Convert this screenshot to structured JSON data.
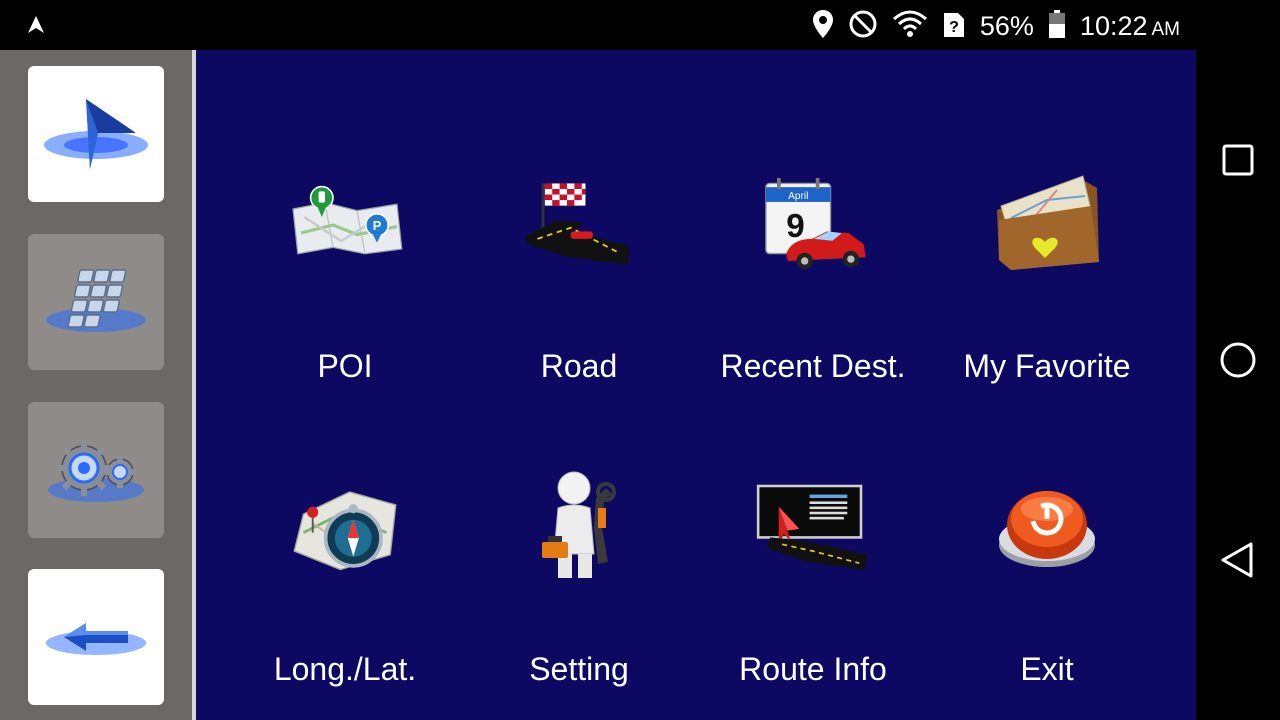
{
  "status_bar": {
    "battery_percent": "56%",
    "time": "10:22",
    "ampm": "AM",
    "icons": [
      "navigation-arrow-icon",
      "location-pin-icon",
      "do-not-disturb-icon",
      "wifi-icon",
      "sim-unknown-icon",
      "battery-icon"
    ]
  },
  "sidebar": {
    "items": [
      {
        "name": "navigate",
        "icon": "navigation-arrow-icon"
      },
      {
        "name": "keypad",
        "icon": "keypad-icon"
      },
      {
        "name": "settings",
        "icon": "gears-icon"
      },
      {
        "name": "back",
        "icon": "back-arrow-icon"
      }
    ]
  },
  "menu": {
    "items": [
      {
        "label": "POI",
        "icon": "map-poi-icon"
      },
      {
        "label": "Road",
        "icon": "road-flag-icon"
      },
      {
        "label": "Recent Dest.",
        "icon": "calendar-car-icon",
        "calendar_month": "April",
        "calendar_day": "9"
      },
      {
        "label": "My Favorite",
        "icon": "wallet-map-icon"
      },
      {
        "label": "Long./Lat.",
        "icon": "compass-map-icon"
      },
      {
        "label": "Setting",
        "icon": "mechanic-figure-icon"
      },
      {
        "label": "Route Info",
        "icon": "route-board-icon"
      },
      {
        "label": "Exit",
        "icon": "power-button-icon"
      }
    ]
  },
  "navbar": {
    "items": [
      "recents-square-icon",
      "home-circle-icon",
      "back-triangle-icon"
    ]
  },
  "colors": {
    "main_bg": "#0d0963",
    "sidebar_bg": "#6b6866",
    "accent_blue": "#2a6bff"
  }
}
